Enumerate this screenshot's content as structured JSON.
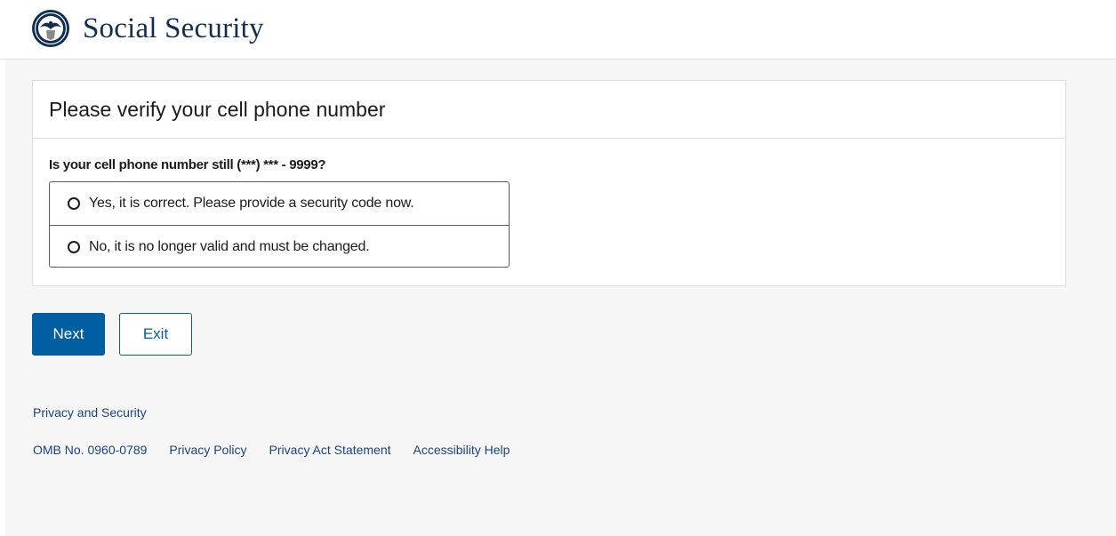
{
  "header": {
    "brand": "Social Security",
    "logo_icon": "ssa-seal-icon"
  },
  "card": {
    "title": "Please verify your cell phone number",
    "question": "Is your cell phone number still (***) *** - 9999?",
    "options": [
      {
        "label": "Yes, it is correct. Please provide a security code now.",
        "selected": false
      },
      {
        "label": "No, it is no longer valid and must be changed.",
        "selected": false
      }
    ]
  },
  "actions": {
    "next_label": "Next",
    "exit_label": "Exit"
  },
  "footer": {
    "privacy_security": "Privacy and Security",
    "omb": "OMB No. 0960-0789",
    "links": [
      "Privacy Policy",
      "Privacy Act Statement",
      "Accessibility Help"
    ]
  },
  "colors": {
    "primary": "#005ea2",
    "brand_text": "#112e51",
    "link": "#1a4480",
    "page_bg": "#f6f6f6"
  }
}
